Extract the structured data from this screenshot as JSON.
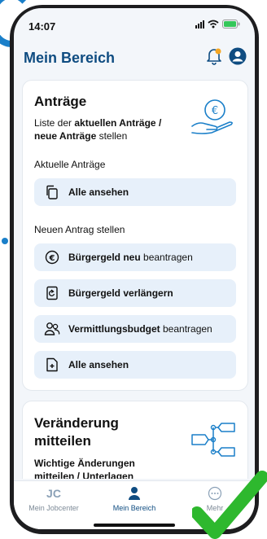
{
  "status": {
    "time": "14:07"
  },
  "header": {
    "title": "Mein Bereich",
    "bell_icon": "bell-icon",
    "profile_icon": "user-icon"
  },
  "antraege": {
    "title": "Anträge",
    "subtitle_pre": "Liste der ",
    "subtitle_bold1": "aktuellen Anträge /",
    "subtitle_bold2": "neue Anträge",
    "subtitle_post": " stellen",
    "current_label": "Aktuelle Anträge",
    "current_all": "Alle ansehen",
    "new_label": "Neuen Antrag stellen",
    "buergergeld_neu_bold": "Bürgergeld neu",
    "buergergeld_neu_rest": " beantragen",
    "verlaengern": "Bürgergeld verlängern",
    "vermittlung_bold": "Vermittlungsbudget",
    "vermittlung_rest": " beantragen",
    "new_all": "Alle ansehen"
  },
  "veraenderung": {
    "title_line1": "Veränderung",
    "title_line2": "mitteilen",
    "subtitle_line1": "Wichtige Änderungen",
    "subtitle_line2": "mitteilen / Unterlagen"
  },
  "tabs": [
    {
      "label": "Mein Jobcenter",
      "icon_text": "JC"
    },
    {
      "label": "Mein Bereich"
    },
    {
      "label": "Mehr"
    }
  ],
  "colors": {
    "brand": "#0f4c81",
    "button_bg": "#e7f0fa",
    "check": "#2eb82e"
  }
}
